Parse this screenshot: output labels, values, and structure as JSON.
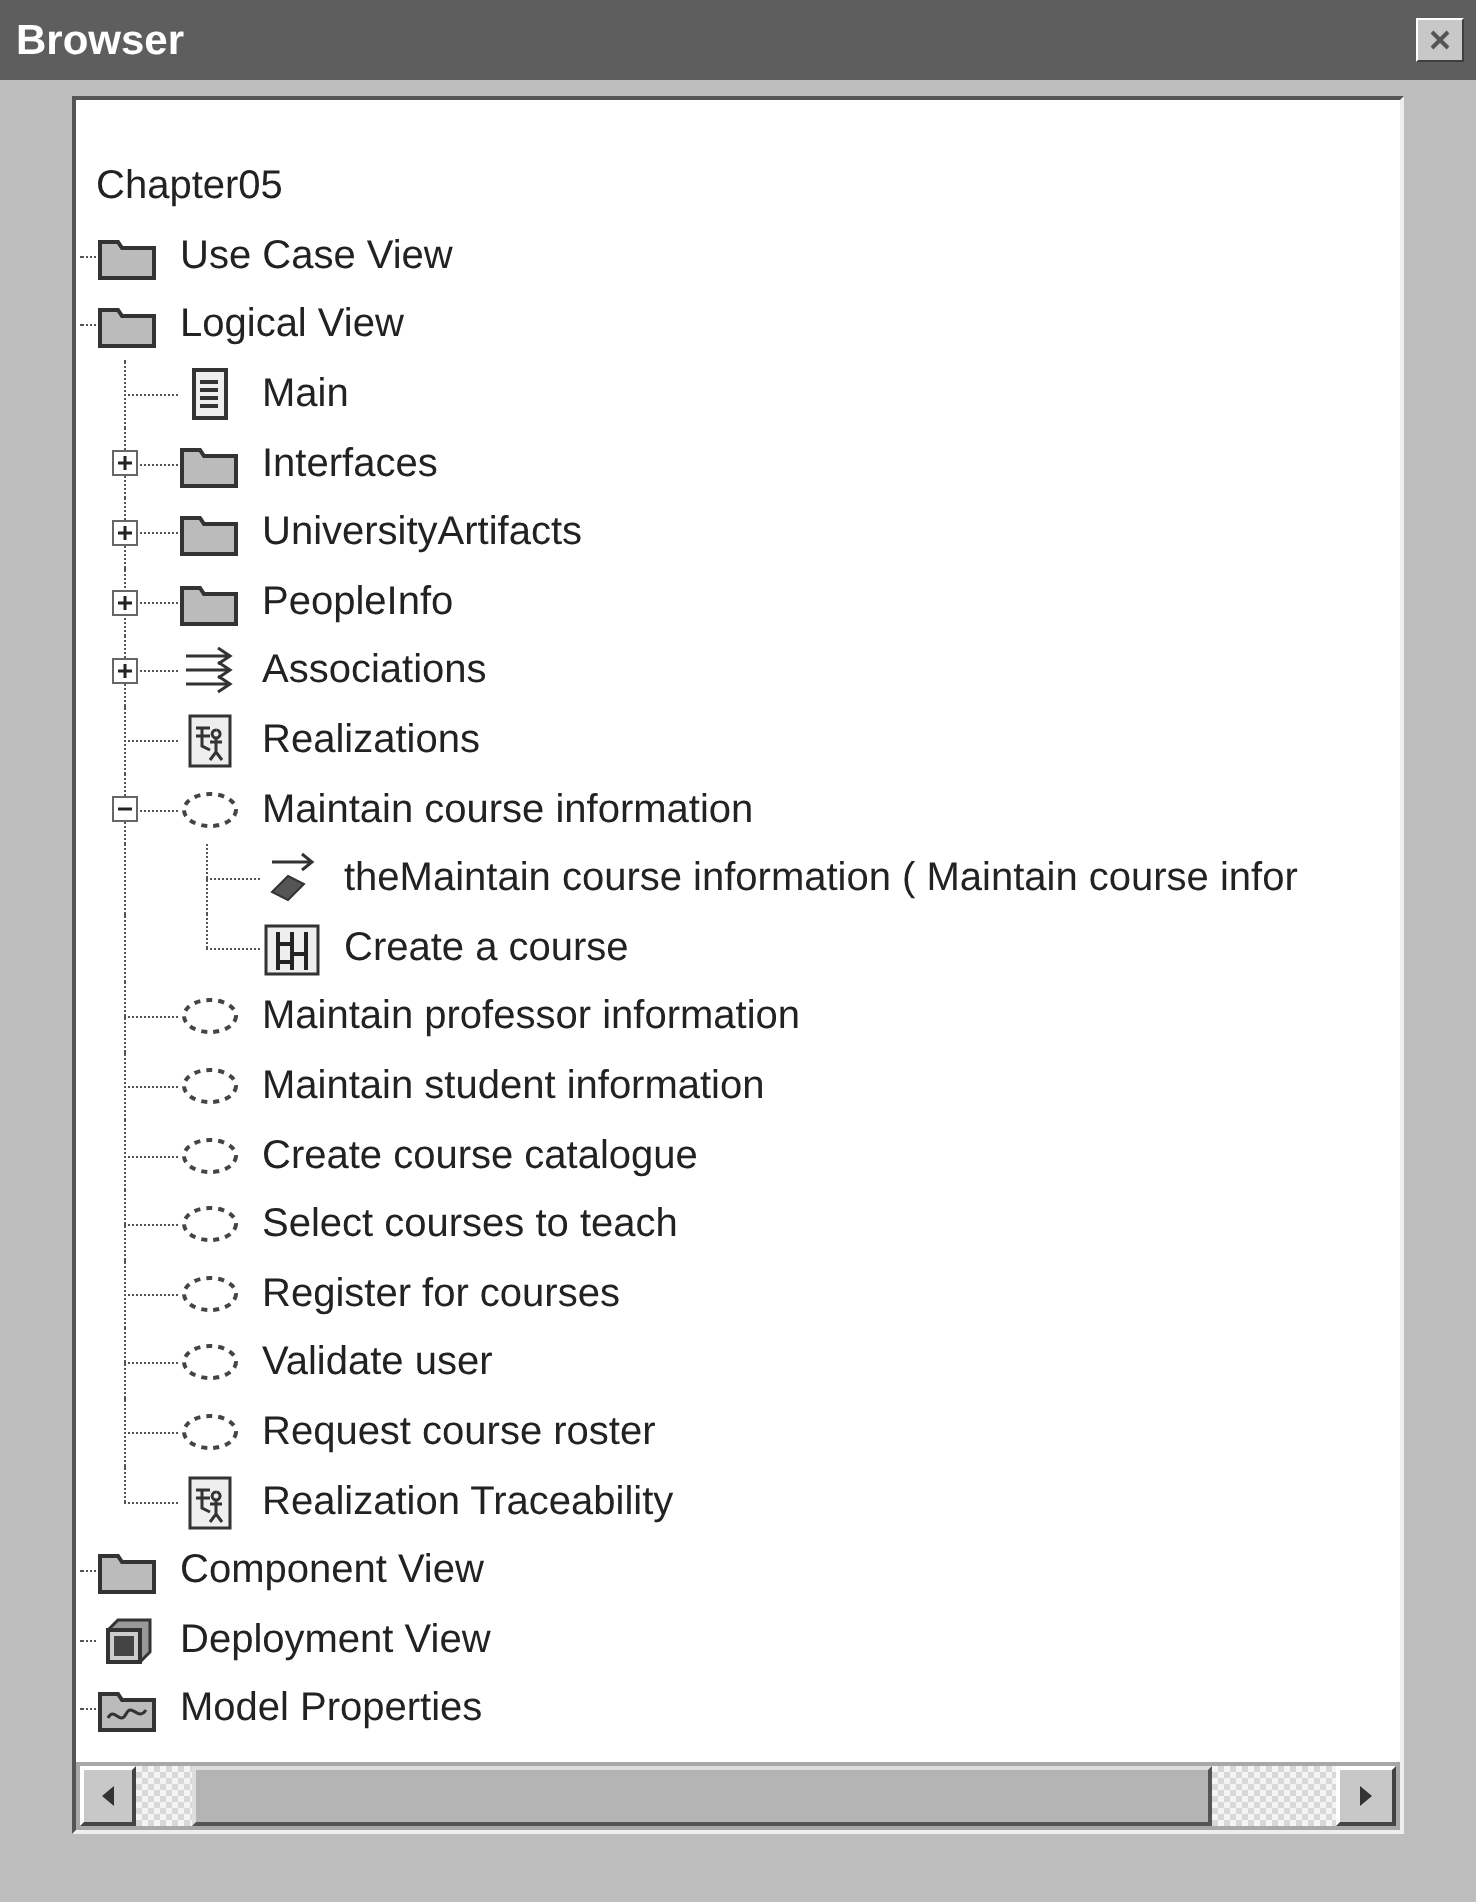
{
  "window": {
    "title": "Browser"
  },
  "tree": {
    "label": "Chapter05",
    "children": [
      {
        "label": "Use Case View",
        "kind": "folder"
      },
      {
        "label": "Logical View",
        "kind": "folder",
        "children": [
          {
            "label": "Main",
            "kind": "diagram"
          },
          {
            "label": "Interfaces",
            "kind": "folder",
            "expanded": false
          },
          {
            "label": "UniversityArtifacts",
            "kind": "folder",
            "expanded": false
          },
          {
            "label": "PeopleInfo",
            "kind": "folder",
            "expanded": false
          },
          {
            "label": "Associations",
            "kind": "associations",
            "expanded": false
          },
          {
            "label": "Realizations",
            "kind": "realization"
          },
          {
            "label": "Maintain course information",
            "kind": "usecase",
            "expanded": true,
            "children": [
              {
                "label": "theMaintain course information ( Maintain course infor",
                "kind": "link"
              },
              {
                "label": "Create a course",
                "kind": "scenario"
              }
            ]
          },
          {
            "label": "Maintain professor information",
            "kind": "usecase"
          },
          {
            "label": "Maintain student information",
            "kind": "usecase"
          },
          {
            "label": "Create course catalogue",
            "kind": "usecase"
          },
          {
            "label": "Select courses to teach",
            "kind": "usecase"
          },
          {
            "label": "Register for courses",
            "kind": "usecase"
          },
          {
            "label": "Validate user",
            "kind": "usecase"
          },
          {
            "label": "Request course roster",
            "kind": "usecase"
          },
          {
            "label": "Realization Traceability",
            "kind": "realization"
          }
        ]
      },
      {
        "label": "Component View",
        "kind": "folder"
      },
      {
        "label": "Deployment View",
        "kind": "deployment"
      },
      {
        "label": "Model Properties",
        "kind": "properties"
      }
    ]
  }
}
